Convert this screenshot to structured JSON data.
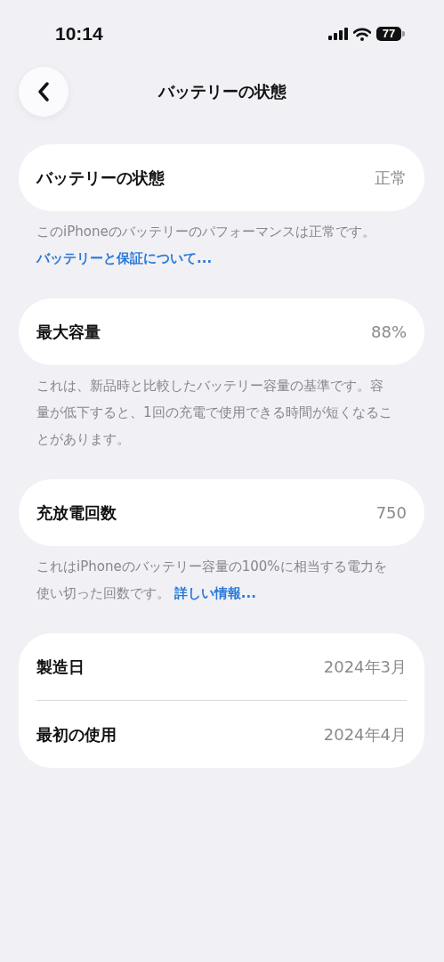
{
  "status_bar": {
    "time": "10:14",
    "battery": "77"
  },
  "nav": {
    "title": "バッテリーの状態"
  },
  "sections": [
    {
      "rows": [
        {
          "label": "バッテリーの状態",
          "value": "正常"
        }
      ],
      "footer": {
        "text": "このiPhoneのバッテリーのパフォーマンスは正常です。",
        "link": "バッテリーと保証について...",
        "kind": "block"
      }
    },
    {
      "rows": [
        {
          "label": "最大容量",
          "value": "88%"
        }
      ],
      "footer": {
        "text": "これは、新品時と比較したバッテリー容量の基準です。容量が低下すると、1回の充電で使用できる時間が短くなることがあります。"
      }
    },
    {
      "rows": [
        {
          "label": "充放電回数",
          "value": "750"
        }
      ],
      "footer": {
        "text": "これはiPhoneのバッテリー容量の100%に相当する電力を使い切った回数です。",
        "link": "詳しい情報...",
        "kind": "inline"
      }
    },
    {
      "rows": [
        {
          "label": "製造日",
          "value": "2024年3月"
        },
        {
          "label": "最初の使用",
          "value": "2024年4月"
        }
      ]
    }
  ]
}
